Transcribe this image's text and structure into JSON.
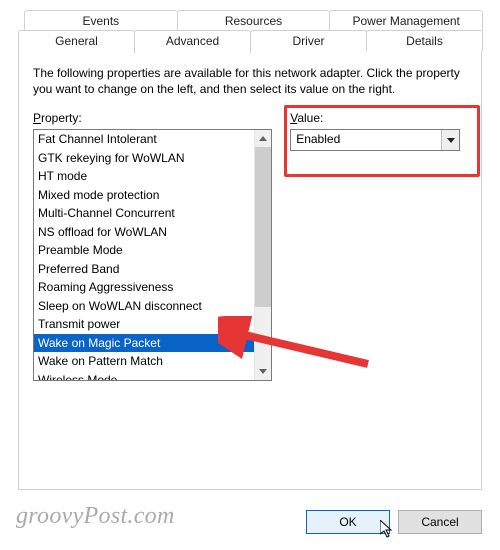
{
  "tabs": {
    "row1": [
      "Events",
      "Resources",
      "Power Management"
    ],
    "row2": [
      "General",
      "Advanced",
      "Driver",
      "Details"
    ],
    "active": "Advanced"
  },
  "panel": {
    "description": "The following properties are available for this network adapter. Click the property you want to change on the left, and then select its value on the right.",
    "propertyLabel": "Property:",
    "valueLabel": "Value:"
  },
  "properties": [
    "Fat Channel Intolerant",
    "GTK rekeying for WoWLAN",
    "HT mode",
    "Mixed mode protection",
    "Multi-Channel Concurrent",
    "NS offload for WoWLAN",
    "Preamble Mode",
    "Preferred Band",
    "Roaming Aggressiveness",
    "Sleep on WoWLAN disconnect",
    "Transmit power",
    "Wake on Magic Packet",
    "Wake on Pattern Match",
    "Wireless Mode"
  ],
  "selectedProperty": "Wake on Magic Packet",
  "valueDropdown": {
    "selected": "Enabled"
  },
  "buttons": {
    "ok": "OK",
    "cancel": "Cancel"
  },
  "watermark": "groovyPost.com",
  "colors": {
    "highlight": "#e63535",
    "selection": "#0a64c8"
  }
}
